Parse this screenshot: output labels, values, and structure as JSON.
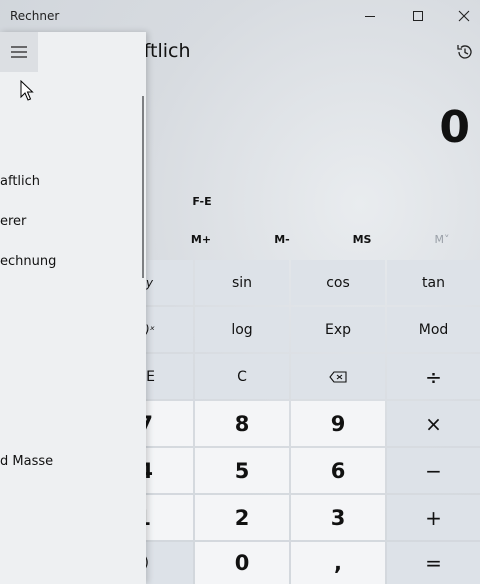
{
  "window": {
    "title": "Rechner",
    "controls": {
      "minimize_icon": "minimize-icon",
      "maximize_icon": "maximize-icon",
      "close_icon": "close-icon"
    }
  },
  "header": {
    "mode_title": "aftlich",
    "history_icon": "history-icon"
  },
  "display": {
    "value": "0"
  },
  "fe_label": "F-E",
  "memory": {
    "m_plus": "M+",
    "m_minus": "M-",
    "ms": "MS",
    "m_list": "M˅"
  },
  "keys": {
    "partial_left": [
      "y",
      ")ˣ",
      "E",
      "7",
      "4",
      "1",
      ")"
    ],
    "row_trig": [
      "sin",
      "cos",
      "tan"
    ],
    "row_log": [
      "log",
      "Exp",
      "Mod"
    ],
    "row_clear": [
      "C",
      "⌫",
      "÷"
    ],
    "row_789": [
      "8",
      "9",
      "×"
    ],
    "row_456": [
      "5",
      "6",
      "−"
    ],
    "row_123": [
      "2",
      "3",
      "+"
    ],
    "row_0": [
      "0",
      ",",
      "="
    ]
  },
  "nav": {
    "items": [
      "aftlich",
      "erer",
      "echnung",
      "d Masse"
    ],
    "menu_icon": "hamburger-icon"
  },
  "colors": {
    "nav_bg": "#eef0f2",
    "number_key_bg": "#f4f5f7",
    "function_key_bg": "#dde2e8"
  }
}
